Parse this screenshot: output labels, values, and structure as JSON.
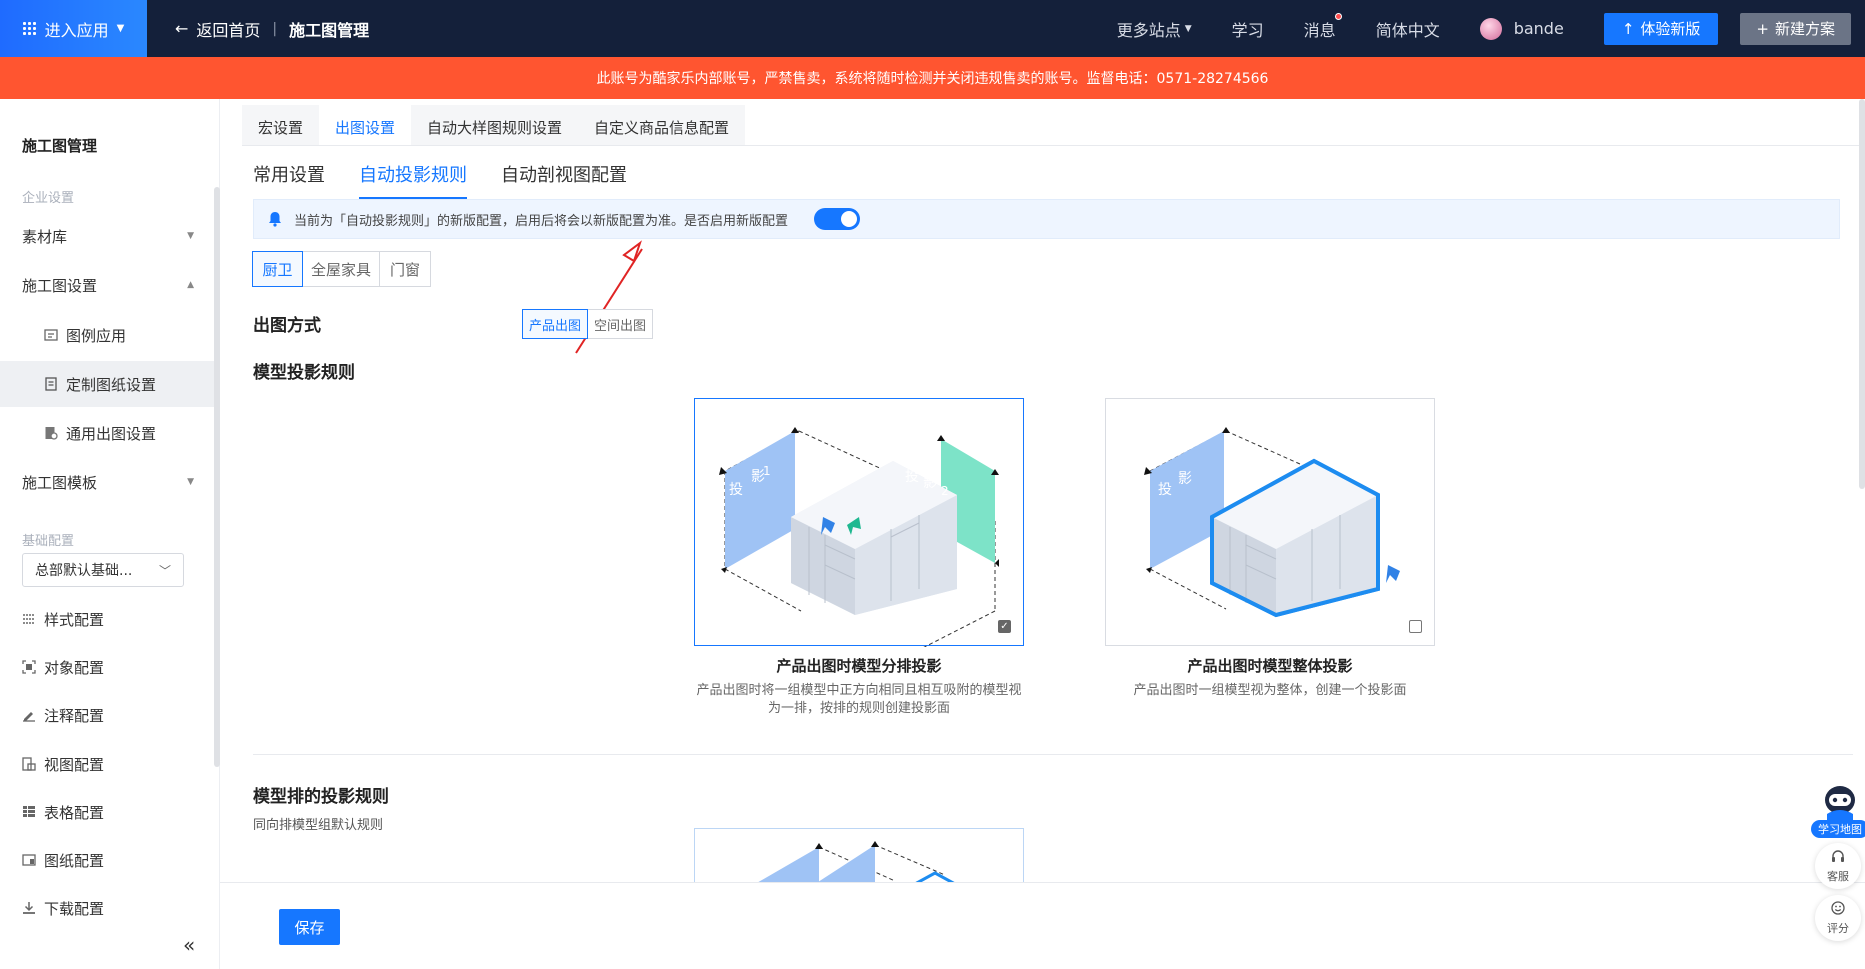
{
  "topbar": {
    "app_menu_label": "进入应用",
    "back_label": "返回首页",
    "breadcrumb_current": "施工图管理",
    "more_sites": "更多站点",
    "learn": "学习",
    "messages": "消息",
    "language": "简体中文",
    "username": "bande",
    "try_new_button": "体验新版",
    "new_plan_button": "新建方案"
  },
  "warning_text": "此账号为酷家乐内部账号，严禁售卖，系统将随时检测并关闭违规售卖的账号。监督电话：0571-28274566",
  "sidebar": {
    "title": "施工图管理",
    "group_enterprise": "企业设置",
    "item_material": "素材库",
    "item_drawing_settings": "施工图设置",
    "sub_legend": "图例应用",
    "sub_custom": "定制图纸设置",
    "sub_general": "通用出图设置",
    "item_template": "施工图模板",
    "group_basic": "基础配置",
    "select_value": "总部默认基础...",
    "style": "样式配置",
    "object": "对象配置",
    "annotation": "注释配置",
    "view": "视图配置",
    "table": "表格配置",
    "sheet": "图纸配置",
    "download": "下载配置"
  },
  "outer_tabs": [
    "宏设置",
    "出图设置",
    "自动大样图规则设置",
    "自定义商品信息配置"
  ],
  "inner_tabs": [
    "常用设置",
    "自动投影规则",
    "自动剖视图配置"
  ],
  "notice": {
    "text": "当前为「自动投影规则」的新版配置，启用后将会以新版配置为准。是否启用新版配置",
    "enabled": true
  },
  "category_tabs": [
    "厨卫",
    "全屋家具",
    "门窗"
  ],
  "output_mode": {
    "label": "出图方式",
    "options": [
      "产品出图",
      "空间出图"
    ]
  },
  "section_projection": "模型投影规则",
  "cards": [
    {
      "title": "产品出图时模型分排投影",
      "desc_line1": "产品出图时将一组模型中正方向相同且相互吸附的模型视",
      "desc_line2": "为一排，按排的规则创建投影面",
      "checked": true,
      "label_a": "投",
      "label_b": "影",
      "num_a": "1",
      "num_b": "2"
    },
    {
      "title": "产品出图时模型整体投影",
      "desc_line1": "产品出图时一组模型视为整体，创建一个投影面",
      "checked": false,
      "label_a": "投",
      "label_b": "影"
    }
  ],
  "section_row_rules": "模型排的投影规则",
  "row_rules_note": "同向排模型组默认规则",
  "save_button": "保存",
  "floating": {
    "learn_map": "学习地图",
    "service": "客服",
    "rating": "评分"
  },
  "colors": {
    "primary": "#1677ff",
    "warning": "#ff5530",
    "topbar": "#14203a"
  }
}
